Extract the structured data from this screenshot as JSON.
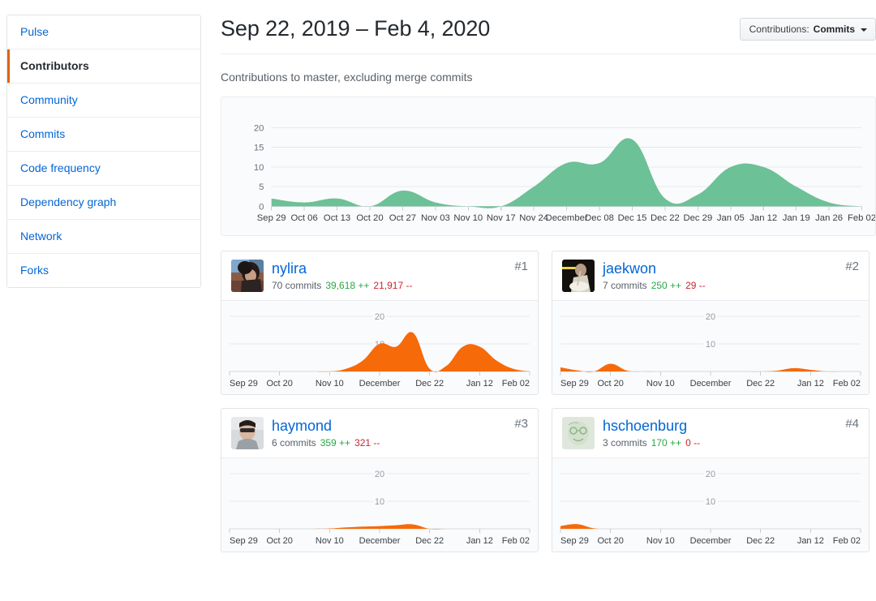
{
  "sidebar": {
    "items": [
      {
        "label": "Pulse",
        "active": false
      },
      {
        "label": "Contributors",
        "active": true
      },
      {
        "label": "Community",
        "active": false
      },
      {
        "label": "Commits",
        "active": false
      },
      {
        "label": "Code frequency",
        "active": false
      },
      {
        "label": "Dependency graph",
        "active": false
      },
      {
        "label": "Network",
        "active": false
      },
      {
        "label": "Forks",
        "active": false
      }
    ]
  },
  "header": {
    "title": "Sep 22, 2019 – Feb 4, 2020",
    "dropdown_label": "Contributions:",
    "dropdown_value": "Commits",
    "dropdown_caret_icon": "chevron-down-icon",
    "subtitle": "Contributions to master, excluding merge commits"
  },
  "colors": {
    "green_area": "#6cc196",
    "orange_area": "#f66a0a",
    "link": "#0366d6",
    "additions": "#28a745",
    "deletions": "#cb2431",
    "active_marker": "#e36209",
    "panel_bg": "#fafbfc",
    "border": "#e1e4e8"
  },
  "chart_data": [
    {
      "id": "summary-chart",
      "type": "area",
      "title": "Contributions to master, excluding merge commits",
      "xlabel": "",
      "ylabel": "",
      "ylim": [
        0,
        22
      ],
      "yticks": [
        0,
        5,
        10,
        15,
        20
      ],
      "grid": true,
      "legend": "none",
      "x": [
        "Sep 29",
        "Oct 06",
        "Oct 13",
        "Oct 20",
        "Oct 27",
        "Nov 03",
        "Nov 10",
        "Nov 17",
        "Nov 24",
        "December",
        "Dec 08",
        "Dec 15",
        "Dec 22",
        "Dec 29",
        "Jan 05",
        "Jan 12",
        "Jan 19",
        "Jan 26",
        "Feb 02"
      ],
      "values": [
        2,
        1,
        2,
        0,
        4,
        1,
        0,
        0,
        5,
        11,
        11,
        17,
        2,
        3,
        10,
        10,
        5,
        1,
        0
      ]
    },
    {
      "id": "nylira-chart",
      "type": "area",
      "ylim": [
        0,
        22
      ],
      "yticks": [
        10,
        20
      ],
      "x": [
        "Sep 29",
        "Oct 20",
        "Nov 10",
        "December",
        "Dec 22",
        "Jan 12",
        "Feb 02"
      ],
      "x_full": [
        "Sep 29",
        "Oct 06",
        "Oct 13",
        "Oct 20",
        "Oct 27",
        "Nov 03",
        "Nov 10",
        "Nov 17",
        "Nov 24",
        "December",
        "Dec 08",
        "Dec 15",
        "Dec 22",
        "Dec 29",
        "Jan 05",
        "Jan 12",
        "Jan 19",
        "Jan 26",
        "Feb 02"
      ],
      "values": [
        0,
        0,
        0,
        0,
        0,
        0,
        0,
        1,
        4,
        10,
        9,
        14,
        1,
        2,
        9,
        9,
        4,
        1,
        0
      ]
    },
    {
      "id": "jaekwon-chart",
      "type": "area",
      "ylim": [
        0,
        22
      ],
      "yticks": [
        10,
        20
      ],
      "x": [
        "Sep 29",
        "Oct 20",
        "Nov 10",
        "December",
        "Dec 22",
        "Jan 12",
        "Feb 02"
      ],
      "x_full": [
        "Sep 29",
        "Oct 06",
        "Oct 13",
        "Oct 20",
        "Oct 27",
        "Nov 03",
        "Nov 10",
        "Nov 17",
        "Nov 24",
        "December",
        "Dec 08",
        "Dec 15",
        "Dec 22",
        "Dec 29",
        "Jan 05",
        "Jan 12",
        "Jan 19",
        "Jan 26",
        "Feb 02"
      ],
      "values": [
        1.5,
        0.4,
        0,
        2.8,
        0.3,
        0,
        0,
        0,
        0,
        0,
        0,
        0,
        0,
        0.3,
        1.2,
        0.6,
        0,
        0,
        0
      ]
    },
    {
      "id": "haymond-chart",
      "type": "area",
      "ylim": [
        0,
        22
      ],
      "yticks": [
        10,
        20
      ],
      "x": [
        "Sep 29",
        "Oct 20",
        "Nov 10",
        "December",
        "Dec 22",
        "Jan 12",
        "Feb 02"
      ],
      "x_full": [
        "Sep 29",
        "Oct 06",
        "Oct 13",
        "Oct 20",
        "Oct 27",
        "Nov 03",
        "Nov 10",
        "Nov 17",
        "Nov 24",
        "December",
        "Dec 08",
        "Dec 15",
        "Dec 22",
        "Dec 29",
        "Jan 05",
        "Jan 12",
        "Jan 19",
        "Jan 26",
        "Feb 02"
      ],
      "values": [
        0,
        0,
        0,
        0,
        0,
        0,
        0.1,
        0.5,
        0.8,
        1.0,
        1.3,
        1.6,
        0,
        0,
        0,
        0,
        0,
        0,
        0
      ]
    },
    {
      "id": "hschoenburg-chart",
      "type": "area",
      "ylim": [
        0,
        22
      ],
      "yticks": [
        10,
        20
      ],
      "x": [
        "Sep 29",
        "Oct 20",
        "Nov 10",
        "December",
        "Dec 22",
        "Jan 12",
        "Feb 02"
      ],
      "x_full": [
        "Sep 29",
        "Oct 06",
        "Oct 13",
        "Oct 20",
        "Oct 27",
        "Nov 03",
        "Nov 10",
        "Nov 17",
        "Nov 24",
        "December",
        "Dec 08",
        "Dec 15",
        "Dec 22",
        "Dec 29",
        "Jan 05",
        "Jan 12",
        "Jan 19",
        "Jan 26",
        "Feb 02"
      ],
      "values": [
        1.0,
        1.7,
        0.2,
        0,
        0,
        0,
        0,
        0,
        0,
        0,
        0,
        0,
        0,
        0,
        0,
        0,
        0,
        0,
        0
      ]
    }
  ],
  "contributors": [
    {
      "username": "nylira",
      "rank": "#1",
      "commits": "70 commits",
      "additions": "39,618 ++",
      "deletions": "21,917 --",
      "avatar": "nylira-avatar",
      "chart": "nylira-chart"
    },
    {
      "username": "jaekwon",
      "rank": "#2",
      "commits": "7 commits",
      "additions": "250 ++",
      "deletions": "29 --",
      "avatar": "jaekwon-avatar",
      "chart": "jaekwon-chart"
    },
    {
      "username": "haymond",
      "rank": "#3",
      "commits": "6 commits",
      "additions": "359 ++",
      "deletions": "321 --",
      "avatar": "haymond-avatar",
      "chart": "haymond-chart"
    },
    {
      "username": "hschoenburg",
      "rank": "#4",
      "commits": "3 commits",
      "additions": "170 ++",
      "deletions": "0 --",
      "avatar": "hschoenburg-avatar",
      "chart": "hschoenburg-chart"
    }
  ]
}
